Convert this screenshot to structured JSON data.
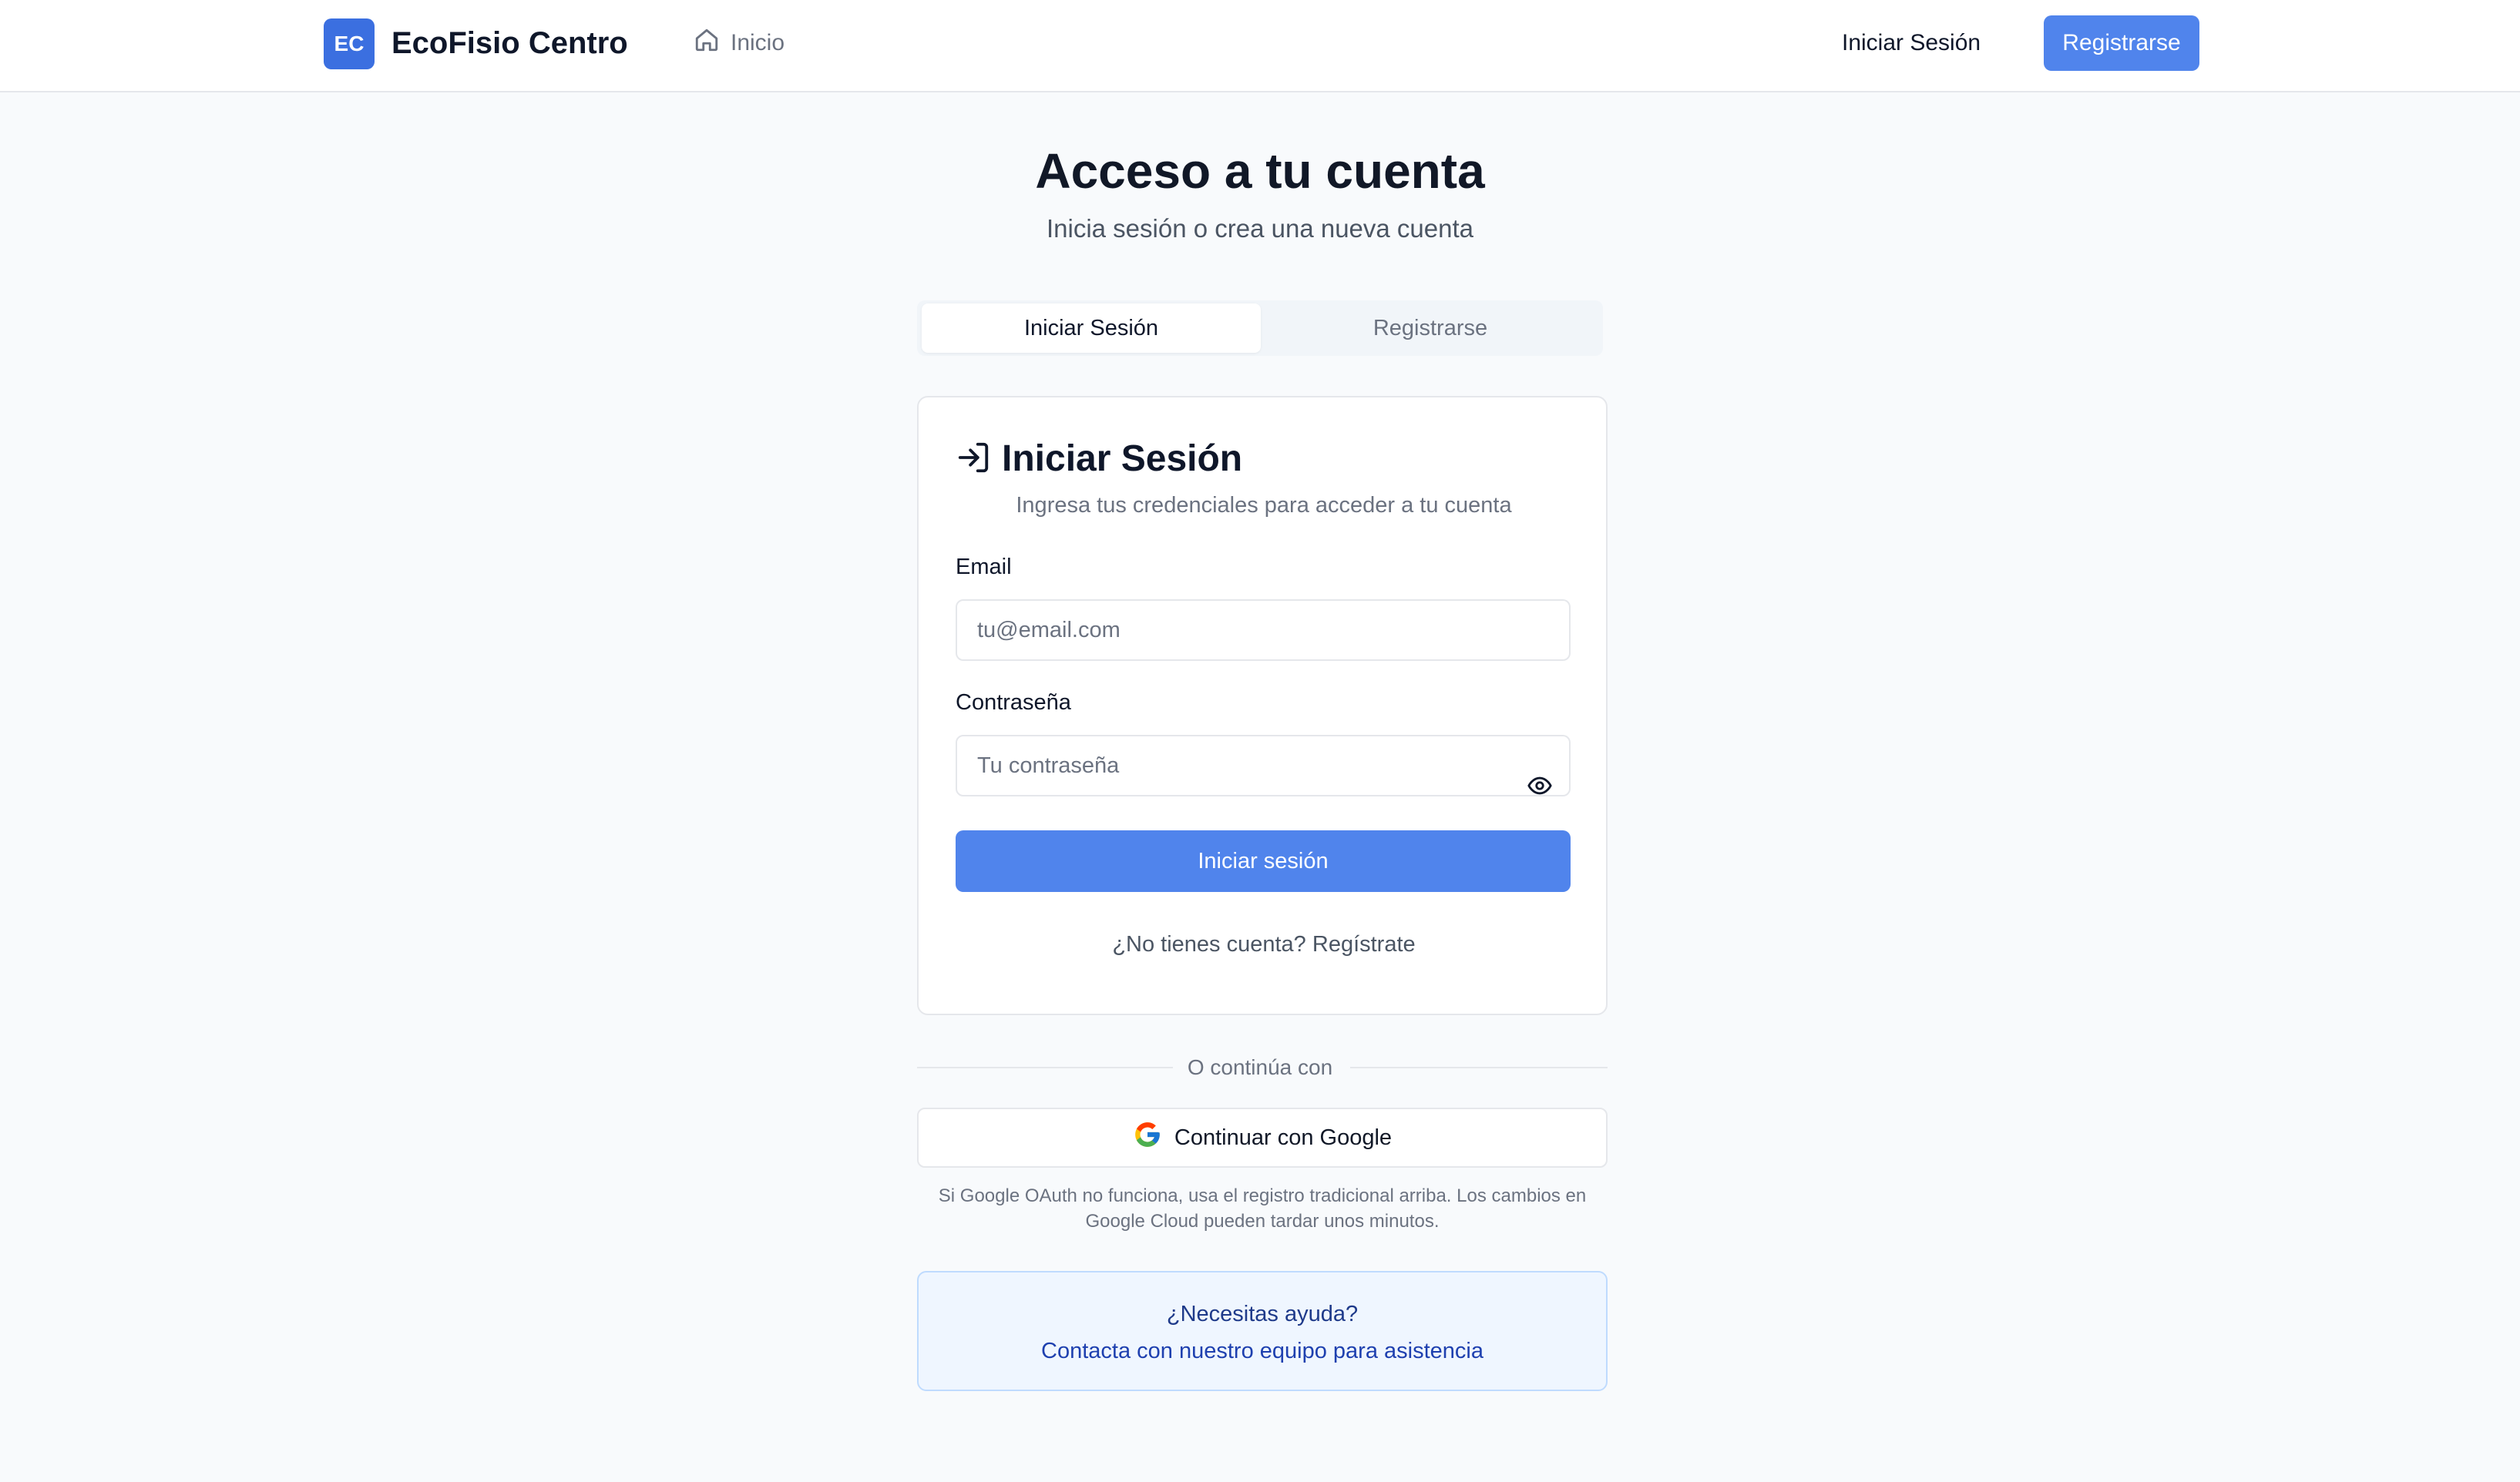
{
  "header": {
    "logo_initials": "EC",
    "brand": "EcoFisio Centro",
    "nav_home": "Inicio",
    "login_link": "Iniciar Sesión",
    "register_button": "Registrarse"
  },
  "page": {
    "title": "Acceso a tu cuenta",
    "subtitle": "Inicia sesión o crea una nueva cuenta"
  },
  "tabs": [
    {
      "label": "Iniciar Sesión",
      "active": true
    },
    {
      "label": "Registrarse",
      "active": false
    }
  ],
  "login_card": {
    "title": "Iniciar Sesión",
    "description": "Ingresa tus credenciales para acceder a tu cuenta",
    "email_label": "Email",
    "email_placeholder": "tu@email.com",
    "email_value": "",
    "password_label": "Contraseña",
    "password_placeholder": "Tu contraseña",
    "password_value": "",
    "submit": "Iniciar sesión",
    "switch_link": "¿No tienes cuenta? Regístrate"
  },
  "social": {
    "divider": "O continúa con",
    "google_button": "Continuar con Google",
    "note": "Si Google OAuth no funciona, usa el registro tradicional arriba. Los cambios en Google Cloud pueden tardar unos minutos."
  },
  "help": {
    "title": "¿Necesitas ayuda?",
    "link": "Contacta con nuestro equipo para asistencia"
  },
  "icons": {
    "home": "home-icon",
    "login": "log-in-icon",
    "eye": "eye-icon",
    "google": "google-icon"
  },
  "colors": {
    "primary": "#5084ec",
    "logo_bg": "#3b6fe0",
    "background": "#f8fafc",
    "help_bg": "#eff6ff",
    "help_text": "#1e3a8a"
  }
}
